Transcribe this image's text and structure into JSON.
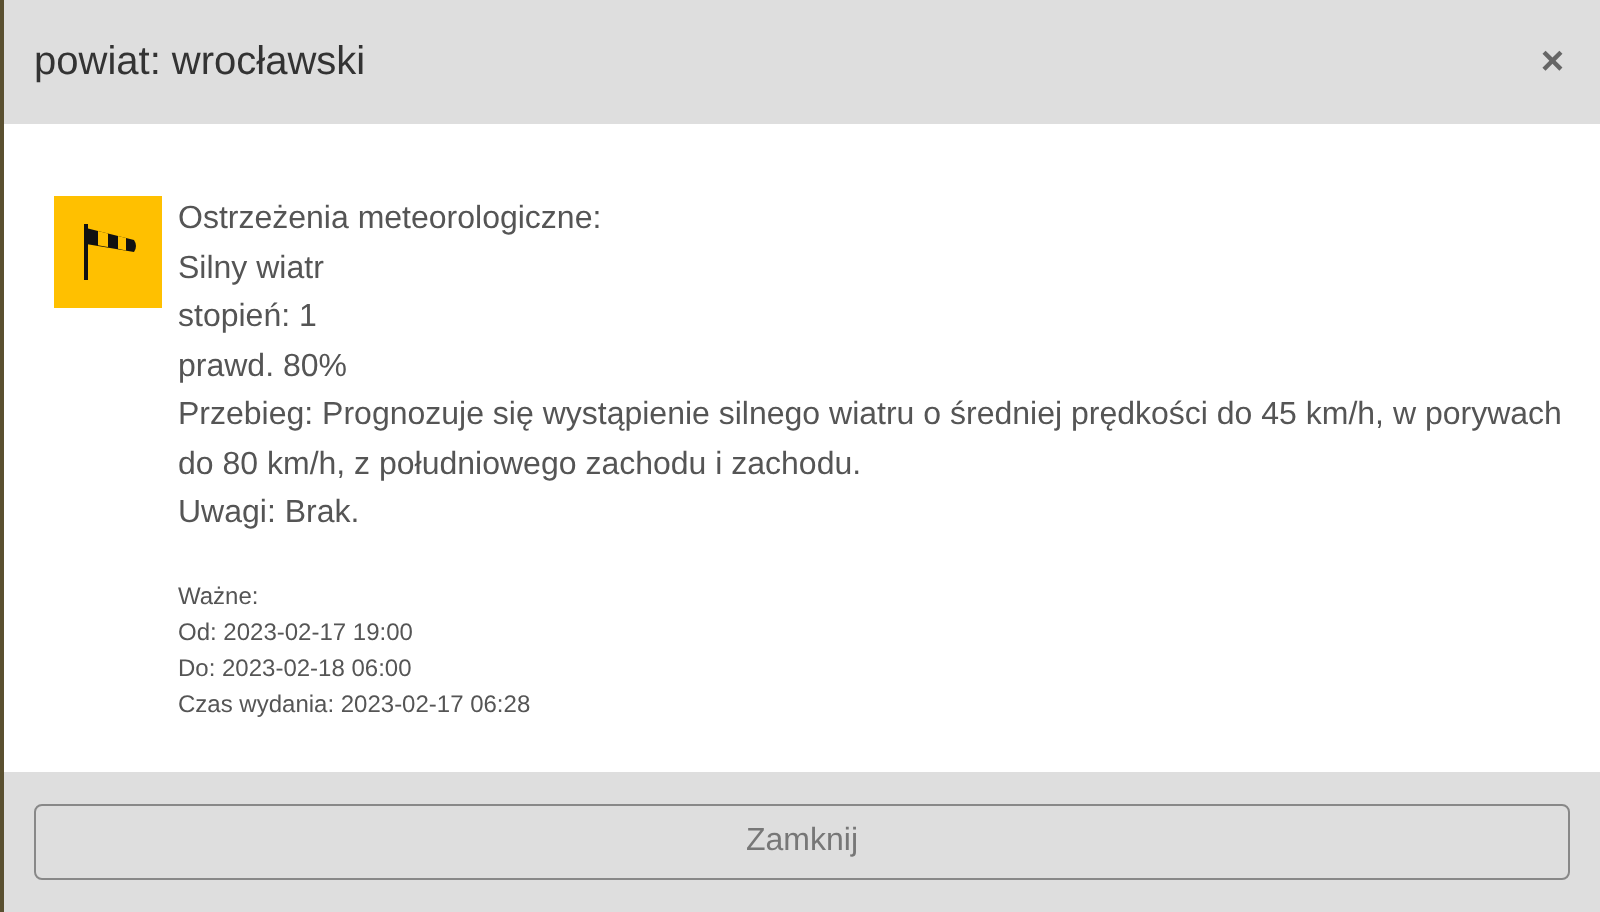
{
  "dialog": {
    "title": "powiat: wrocławski",
    "close": "×"
  },
  "warning": {
    "heading": "Ostrzeżenia meteorologiczne:",
    "type": "Silny wiatr",
    "degree": "stopień: 1",
    "probability": "prawd. 80%",
    "course": "Przebieg: Prognozuje się wystąpienie silnego wiatru o średniej prędkości do 45 km/h, w porywach do 80 km/h, z południowego zachodu i zachodu.",
    "remarks": "Uwagi: Brak."
  },
  "validity": [
    "Ważne:",
    "Od: 2023-02-17 19:00",
    "Do: 2023-02-18 06:00",
    "Czas wydania: 2023-02-17 06:28"
  ],
  "footer": {
    "button": "Zamknij"
  }
}
